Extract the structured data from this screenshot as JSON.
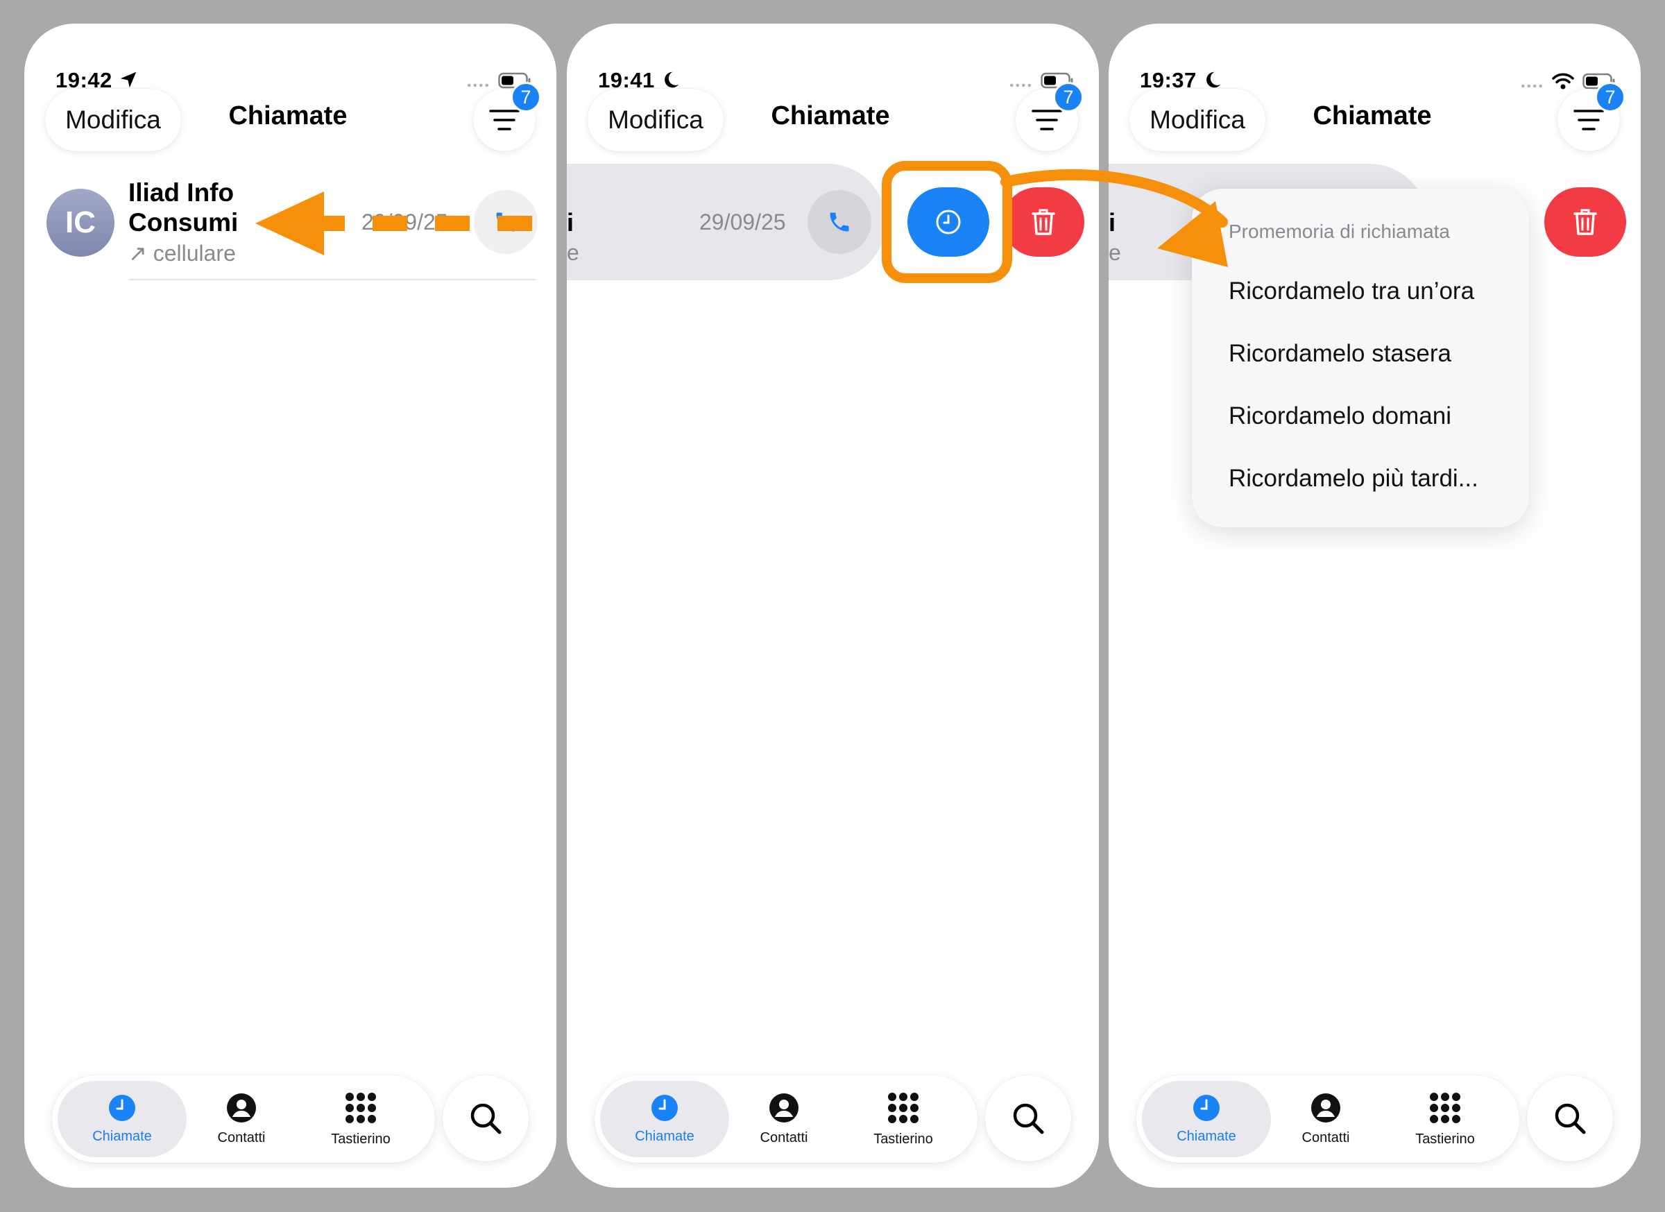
{
  "panels": [
    {
      "status": {
        "time": "19:42",
        "time_glyph": "location-arrow-icon"
      },
      "header": {
        "edit_label": "Modifica",
        "title": "Chiamate",
        "badge_count": "7"
      },
      "call_row": {
        "avatar_initials": "IC",
        "name": "Iliad Info Consumi",
        "type": "↗ cellulare",
        "date": "29/09/25"
      },
      "tabbar": {
        "calls": "Chiamate",
        "contacts": "Contatti",
        "keypad": "Tastierino"
      }
    },
    {
      "status": {
        "time": "19:41",
        "time_glyph": "moon-icon"
      },
      "header": {
        "edit_label": "Modifica",
        "title": "Chiamate",
        "badge_count": "7"
      },
      "call_row": {
        "name_fragment": "i",
        "type_fragment": "e",
        "date": "29/09/25"
      },
      "tabbar": {
        "calls": "Chiamate",
        "contacts": "Contatti",
        "keypad": "Tastierino"
      }
    },
    {
      "status": {
        "time": "19:37",
        "time_glyph": "moon-icon"
      },
      "header": {
        "edit_label": "Modifica",
        "title": "Chiamate",
        "badge_count": "7"
      },
      "call_row": {
        "name_fragment": "i",
        "type_fragment": "e"
      },
      "menu": {
        "header": "Promemoria di richiamata",
        "items": [
          "Ricordamelo tra un’ora",
          "Ricordamelo stasera",
          "Ricordamelo domani",
          "Ricordamelo più tardi..."
        ]
      },
      "tabbar": {
        "calls": "Chiamate",
        "contacts": "Contatti",
        "keypad": "Tastierino"
      }
    }
  ],
  "colors": {
    "accent_blue": "#1a82f7",
    "delete_red": "#f23b43",
    "annotation_orange": "#f6900a",
    "background_gray": "#a9a9a9"
  }
}
